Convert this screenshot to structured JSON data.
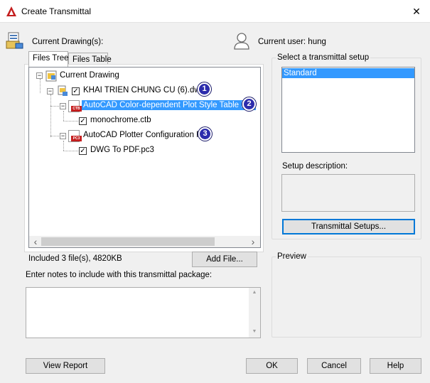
{
  "window": {
    "title": "Create Transmittal",
    "close_glyph": "✕"
  },
  "header": {
    "current_drawings_label": "Current Drawing(s):",
    "current_user_label": "Current user: hung"
  },
  "tabs": [
    {
      "label": "Files Tree",
      "active": true
    },
    {
      "label": "Files Table",
      "active": false
    }
  ],
  "tree": {
    "root": "Current Drawing",
    "drawing": "KHAI TRIEN CHUNG CU (6).dwg",
    "ctb_group": "AutoCAD Color-dependent Plot Style Table File",
    "ctb_file": "monochrome.ctb",
    "pc3_group": "AutoCAD Plotter Configuration File",
    "pc3_file": "DWG To PDF.pc3",
    "ctb_tag": "CTB",
    "pc3_tag": "PC3"
  },
  "badges": [
    "1",
    "2",
    "3"
  ],
  "scroll": {
    "left": "‹",
    "right": "›",
    "up": "▲",
    "down": "▼"
  },
  "status": {
    "included": "Included 3 file(s), 4820KB",
    "add_file_button": "Add File..."
  },
  "notes": {
    "label": "Enter notes to include with this transmittal package:",
    "value": ""
  },
  "setup": {
    "group_label": "Select a transmittal setup",
    "items": [
      "Standard"
    ],
    "selected": "Standard",
    "description_label": "Setup description:",
    "description_value": "",
    "setups_button": "Transmittal Setups..."
  },
  "preview": {
    "label": "Preview"
  },
  "footer": {
    "view_report": "View Report",
    "ok": "OK",
    "cancel": "Cancel",
    "help": "Help"
  },
  "icons": {
    "app": "autocad-icon",
    "drawings": "drawings-icon",
    "user": "user-icon",
    "folder": "folder-icon",
    "dwg": "dwg-file-icon"
  },
  "colors": {
    "selection": "#3399ff",
    "badge": "#2c2cac",
    "autocad_red": "#c41e1e"
  }
}
